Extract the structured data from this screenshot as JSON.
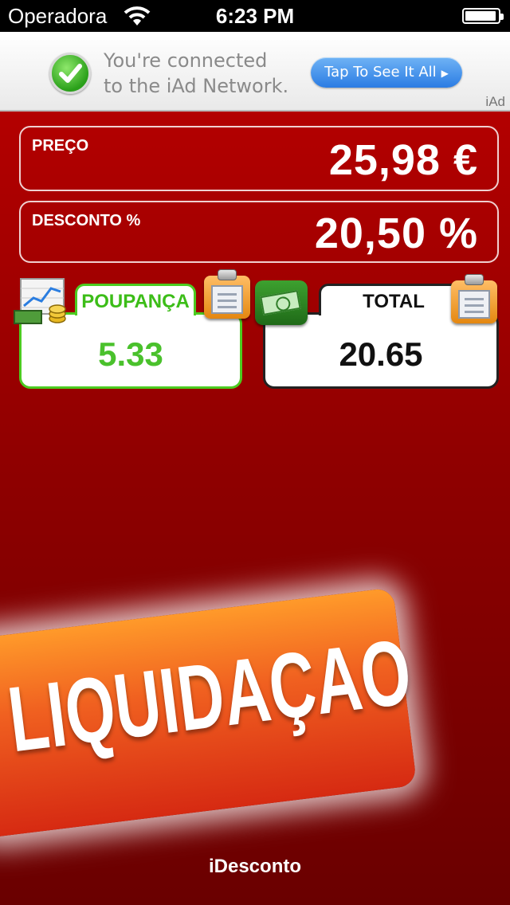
{
  "status_bar": {
    "carrier": "Operadora",
    "time": "6:23 PM"
  },
  "ad_banner": {
    "message_line1": "You're connected",
    "message_line2": "to the iAd Network.",
    "button_label": "Tap To See It All",
    "logo": "iAd"
  },
  "price_field": {
    "label": "PREÇO",
    "value": "25,98 €"
  },
  "discount_field": {
    "label": "DESCONTO %",
    "value": "20,50 %"
  },
  "savings": {
    "label": "POUPANÇA",
    "value": "5.33"
  },
  "total": {
    "label": "TOTAL",
    "value": "20.65"
  },
  "promo": {
    "text": "LIQUIDAÇAO"
  },
  "footer": {
    "app_name": "iDesconto"
  },
  "colors": {
    "background": "#a00000",
    "savings_accent": "#4ccb20",
    "ad_button": "#2b7ce3",
    "promo_orange": "#f06020"
  }
}
